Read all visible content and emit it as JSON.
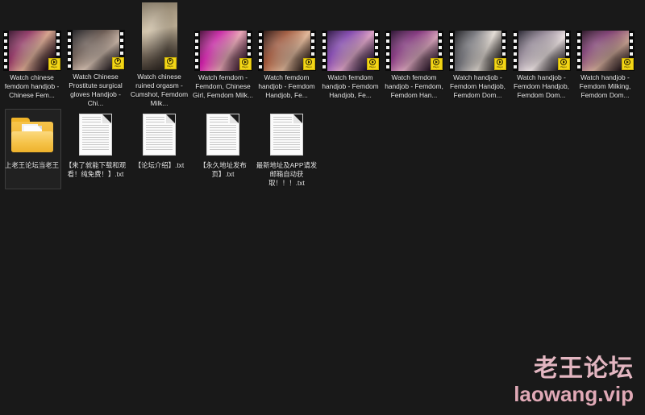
{
  "window": {
    "background_color": "#191919",
    "view_mode": "icons"
  },
  "watermark": {
    "chinese": "老王论坛",
    "latin": "laowang.vip",
    "color": "#e3b6c1"
  },
  "badge": {
    "label": "Player",
    "icon": "play-icon",
    "color": "#f3d617"
  },
  "rows": {
    "videos": [
      {
        "name": "Watch chinese femdom handjob - Chinese Fem...",
        "thumb": "ph1",
        "orientation": "landscape"
      },
      {
        "name": "Watch Chinese Prostitute surgical gloves Handjob - Chi...",
        "thumb": "ph2",
        "orientation": "landscape"
      },
      {
        "name": "Watch chinese ruined orgasm - Cumshot, Femdom Milk...",
        "thumb": "ph3",
        "orientation": "portrait"
      },
      {
        "name": "Watch femdom - Femdom, Chinese Girl, Femdom Milk...",
        "thumb": "ph4",
        "orientation": "landscape"
      },
      {
        "name": "Watch femdom handjob - Femdom Handjob, Fe...",
        "thumb": "ph5",
        "orientation": "landscape"
      },
      {
        "name": "Watch femdom handjob - Femdom Handjob, Fe...",
        "thumb": "ph6",
        "orientation": "landscape"
      },
      {
        "name": "Watch femdom handjob - Femdom, Femdom Han...",
        "thumb": "ph7",
        "orientation": "landscape"
      },
      {
        "name": "Watch handjob - Femdom Handjob, Femdom Dom...",
        "thumb": "ph8",
        "orientation": "landscape"
      },
      {
        "name": "Watch handjob - Femdom Handjob, Femdom Dom...",
        "thumb": "ph9",
        "orientation": "landscape"
      },
      {
        "name": "Watch handjob - Femdom Milking, Femdom Dom...",
        "thumb": "ph10",
        "orientation": "landscape"
      }
    ],
    "documents": [
      {
        "name": "上老王论坛当老王",
        "type": "folder",
        "selected": true
      },
      {
        "name": "【来了就能下载和观看！纯免费！】.txt",
        "type": "text"
      },
      {
        "name": "【论坛介绍】.txt",
        "type": "text"
      },
      {
        "name": "【永久地址发布页】.txt",
        "type": "text"
      },
      {
        "name": "最新地址及APP请发邮箱自动获取！！！.txt",
        "type": "text"
      }
    ]
  }
}
